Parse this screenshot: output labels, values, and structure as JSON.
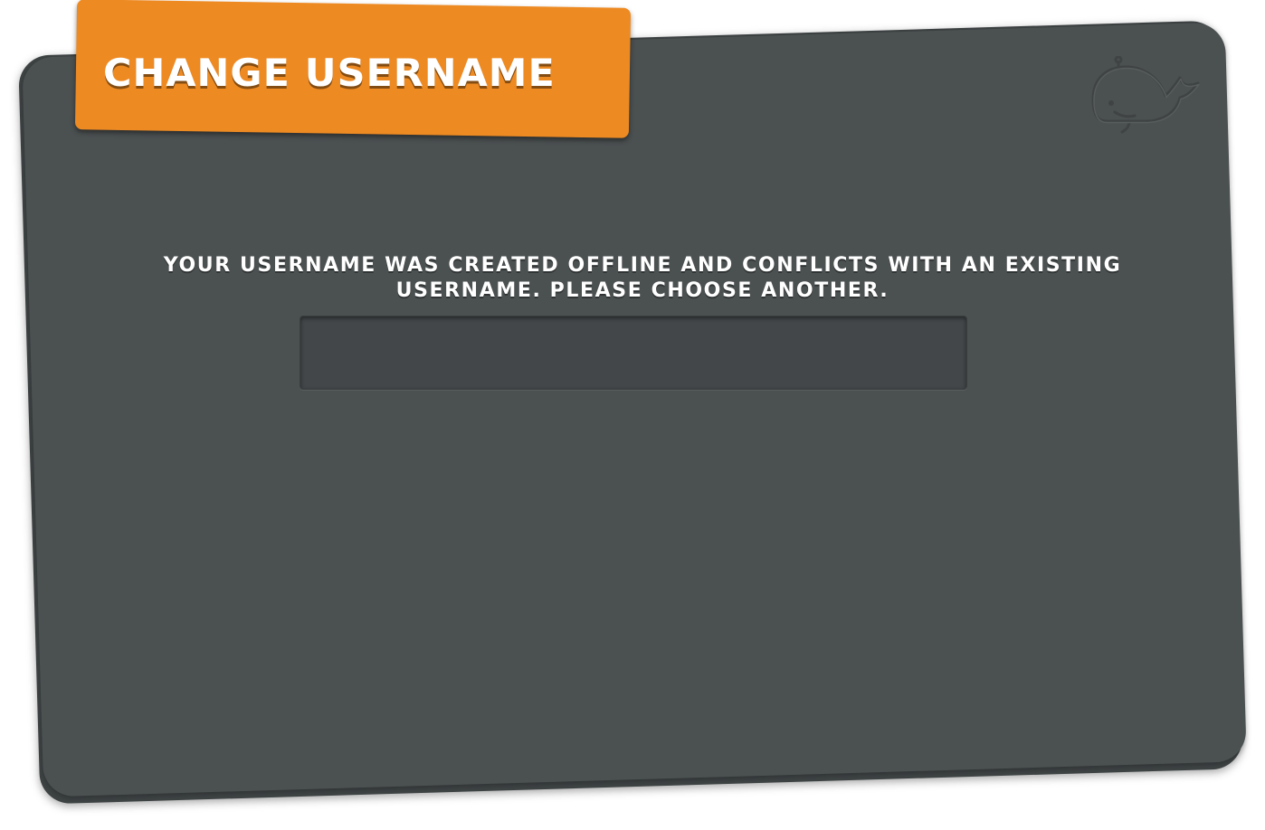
{
  "dialog": {
    "title": "CHANGE USERNAME",
    "message": "YOUR USERNAME WAS CREATED OFFLINE AND CONFLICTS WITH AN EXISTING USERNAME. PLEASE CHOOSE ANOTHER.",
    "logo_icon": "whale-icon",
    "username_input": {
      "value": "",
      "placeholder": ""
    }
  },
  "colors": {
    "card": "#4b5051",
    "card_back": "#3e4344",
    "title_tab": "#ee8a22",
    "text": "#ffffff"
  }
}
